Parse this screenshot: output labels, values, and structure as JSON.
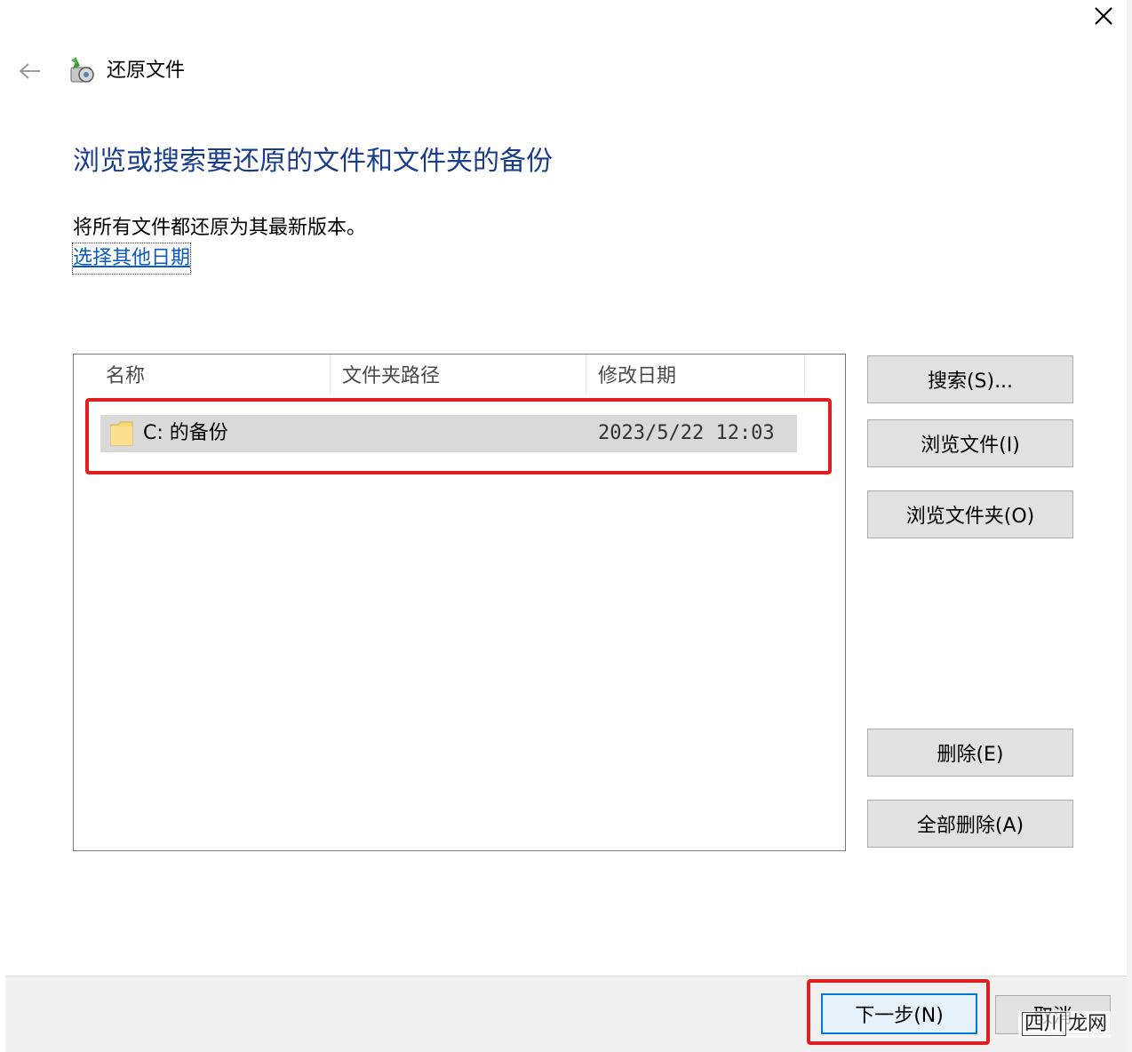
{
  "window": {
    "title": "还原文件",
    "close_glyph": "✕",
    "back_glyph": "←"
  },
  "page": {
    "heading": "浏览或搜索要还原的文件和文件夹的备份",
    "description": "将所有文件都还原为其最新版本。",
    "date_link": "选择其他日期"
  },
  "file_list": {
    "columns": [
      "名称",
      "文件夹路径",
      "修改日期"
    ],
    "rows": [
      {
        "name": "C: 的备份",
        "path": "",
        "modified": "2023/5/22 12:03",
        "icon": "folder-icon"
      }
    ]
  },
  "side_buttons": {
    "search": "搜索(S)...",
    "browse_files": "浏览文件(I)",
    "browse_folders": "浏览文件夹(O)",
    "remove": "删除(E)",
    "remove_all": "全部删除(A)"
  },
  "footer": {
    "next": "下一步(N)",
    "cancel": "取消"
  },
  "watermark": {
    "boxed": "四川",
    "rest": "龙网"
  },
  "colors": {
    "heading": "#1a3d8c",
    "link": "#0a5bc4",
    "highlight": "#e02020",
    "default_button_border": "#0078d7",
    "selected_row": "#d9d9d9",
    "footer_bg": "#f0f0f0"
  }
}
